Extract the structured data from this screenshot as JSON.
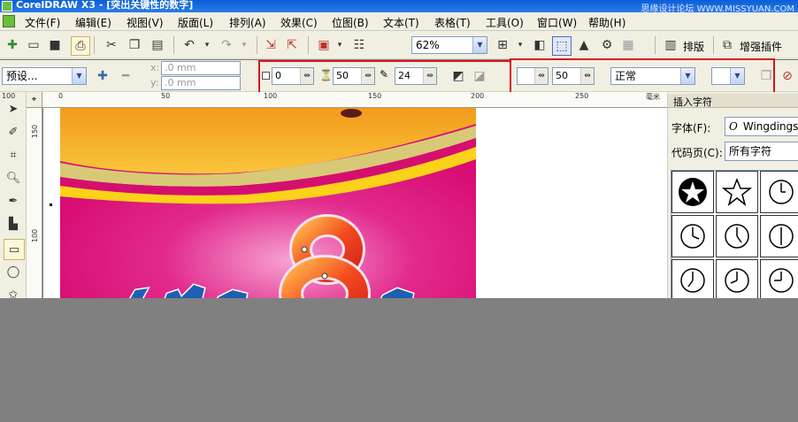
{
  "title_bar": {
    "title": "CorelDRAW X3 - [突出关键性的数字]",
    "watermark": "思缘设计论坛  WWW.MISSYUAN.COM"
  },
  "menu": [
    {
      "label": "文件(F)"
    },
    {
      "label": "编辑(E)"
    },
    {
      "label": "视图(V)"
    },
    {
      "label": "版面(L)"
    },
    {
      "label": "排列(A)"
    },
    {
      "label": "效果(C)"
    },
    {
      "label": "位图(B)"
    },
    {
      "label": "文本(T)"
    },
    {
      "label": "表格(T)"
    },
    {
      "label": "工具(O)"
    },
    {
      "label": "窗口(W)"
    },
    {
      "label": "帮助(H)"
    }
  ],
  "toolbar1": {
    "zoom_value": "62%",
    "arrange_label": "排版",
    "plugin_label": "增强插件"
  },
  "toolbar2": {
    "preset_value": "预设...",
    "x_label": "x:",
    "x_value": ".0 mm",
    "y_label": "y:",
    "y_value": ".0 mm",
    "field_a": "0",
    "field_b": "50",
    "field_c": "24",
    "field_d": "50",
    "mode_value": "正常"
  },
  "ruler": {
    "h_labels": [
      "100",
      "50",
      "0",
      "50",
      "100",
      "150",
      "200",
      "250"
    ],
    "v_labels": [
      "150",
      "100"
    ],
    "unit": "毫米"
  },
  "docker": {
    "title": "插入字符",
    "font_label": "字体(F):",
    "font_value": "Wingdings",
    "codepage_label": "代码页(C):",
    "codepage_value": "所有字符"
  },
  "colors": {
    "accent_red": "#d9141b",
    "magenta": "#e0107a",
    "orange": "#f39a1c"
  }
}
